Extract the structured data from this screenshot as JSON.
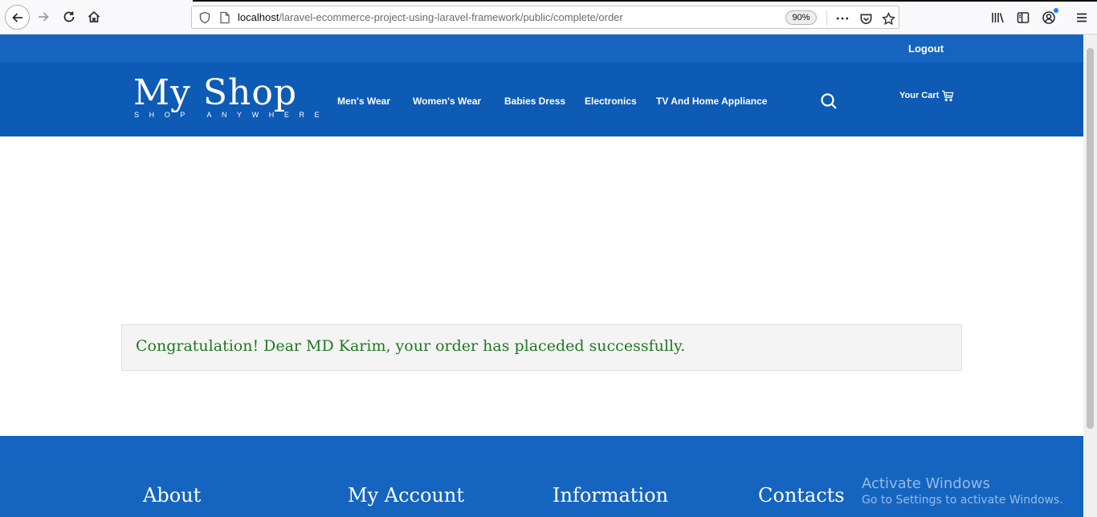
{
  "browser": {
    "url_host": "localhost",
    "url_path": "/laravel-ecommerce-project-using-laravel-framework/public/complete/order",
    "zoom": "90%"
  },
  "top_strip": {
    "logout_label": "Logout"
  },
  "header": {
    "logo_title": "My Shop",
    "logo_tagline": "SHOP ANYWHERE",
    "nav_items": [
      {
        "label": "Men's Wear"
      },
      {
        "label": "Women's Wear"
      },
      {
        "label": "Babies Dress"
      },
      {
        "label": "Electronics"
      },
      {
        "label": "TV And Home Appliance"
      }
    ],
    "cart_label": "Your Cart"
  },
  "alert": {
    "message": "Congratulation! Dear MD Karim, your order has placeded successfully.",
    "color": "#1f7a1f"
  },
  "footer": {
    "headings": [
      "About",
      "My Account",
      "Information",
      "Contacts"
    ]
  },
  "watermark": {
    "title": "Activate Windows",
    "subtitle": "Go to Settings to activate Windows."
  },
  "colors": {
    "top_strip": "#1565c0",
    "header": "#0d5bb5",
    "footer": "#1565c0"
  },
  "icons": [
    "back-icon",
    "forward-icon",
    "reload-icon",
    "home-icon",
    "shield-icon",
    "page-icon",
    "more-icon",
    "pocket-icon",
    "star-icon",
    "library-icon",
    "sidebar-icon",
    "account-icon",
    "menu-icon",
    "search-icon",
    "cart-icon"
  ]
}
